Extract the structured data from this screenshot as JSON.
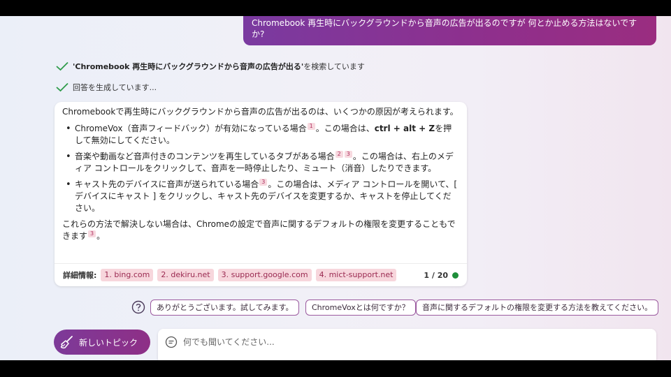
{
  "user_message": "Chromebook 再生時にバックグラウンドから音声の広告が出るのですが 何とか止める方法はないですか?",
  "status": [
    {
      "bold": "'Chromebook 再生時にバックグラウンドから音声の広告が出る'",
      "text": " を検索しています"
    },
    {
      "bold": "",
      "text": "回答を生成しています..."
    }
  ],
  "answer": {
    "intro": "Chromebookで再生時にバックグラウンドから音声の広告が出るのは、いくつかの原因が考えられます。",
    "bullets": [
      {
        "a": "ChromeVox（音声フィードバック）が有効になっている場合",
        "c1": "1",
        "c2": "",
        "b": "。この場合は、",
        "key": "ctrl + alt + Z",
        "d": "を押して無効にしてください。"
      },
      {
        "a": "音楽や動画など音声付きのコンテンツを再生しているタブがある場合",
        "c1": "2",
        "c2": "3",
        "b": "。この場合は、右上のメディア コントロールをクリックして、音声を一時停止したり、ミュート（消音）したりできます。",
        "key": "",
        "d": ""
      },
      {
        "a": "キャスト先のデバイスに音声が送られている場合",
        "c1": "3",
        "c2": "",
        "b": "。この場合は、メディア コントロールを開いて、[ デバイスにキャスト ] をクリックし、キャスト先のデバイスを変更するか、キャストを停止してください。",
        "key": "",
        "d": ""
      }
    ],
    "outro": "これらの方法で解決しない場合は、Chromeの設定で音声に関するデフォルトの権限を変更することもできます",
    "outro_cite": "3",
    "outro_end": "。"
  },
  "footer": {
    "label": "詳細情報:",
    "sources": [
      "1. bing.com",
      "2. dekiru.net",
      "3. support.google.com",
      "4. mict-support.net"
    ],
    "pager": "1 / 20",
    "status_color": "#1f8f3a"
  },
  "suggestions": [
    "ありがとうございます。試してみます。",
    "ChromeVoxとは何ですか？",
    "音声に関するデフォルトの権限を変更する方法を教えてください。"
  ],
  "new_topic_label": "新しいトピック",
  "input": {
    "placeholder": "何でも聞いてください..."
  },
  "icons": {
    "check": "check-icon",
    "help": "question-icon",
    "broom": "broom-icon",
    "chat": "chat-icon"
  },
  "colors": {
    "accent": "#8e2f86",
    "check": "#2e9b4a"
  }
}
